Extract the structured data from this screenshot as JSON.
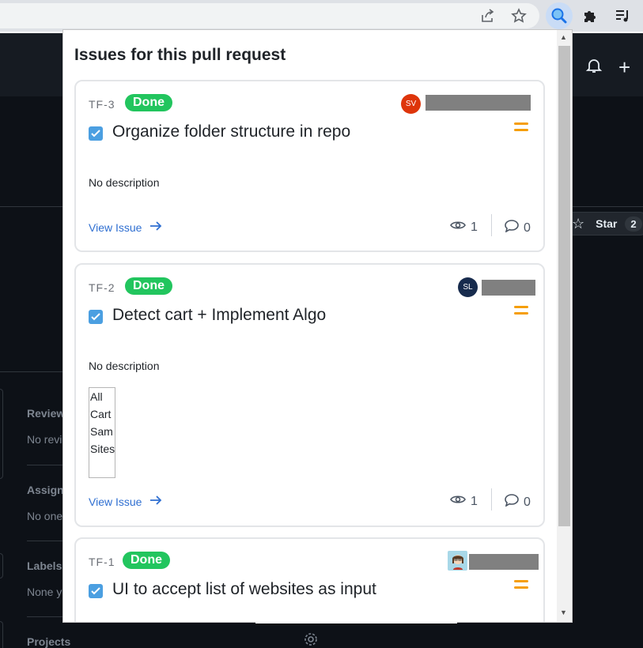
{
  "browser": {
    "icons": [
      "share-icon",
      "bookmark-star-icon",
      "search-extension-icon",
      "puzzle-extensions-icon",
      "reading-list-icon"
    ]
  },
  "github": {
    "star_label": "Star",
    "star_count": "2",
    "sidebar": [
      {
        "label": "Reviewers",
        "value": "No reviewers"
      },
      {
        "label": "Assignees",
        "value": "No one"
      },
      {
        "label": "Labels",
        "value": "None yet"
      },
      {
        "label": "Projects",
        "value": ""
      }
    ]
  },
  "popup": {
    "title": "Issues for this pull request",
    "issues": [
      {
        "key": "TF-3",
        "status": "Done",
        "avatar_initials": "SV",
        "avatar_color": "#de350b",
        "title": "Organize folder structure in repo",
        "description": "No description",
        "view_label": "View Issue",
        "watchers": "1",
        "comments": "0"
      },
      {
        "key": "TF-2",
        "status": "Done",
        "avatar_initials": "SL",
        "avatar_color": "#172b4d",
        "title": "Detect cart + Implement Algo",
        "description": "No description",
        "image_alt": "All Cart Sam Sites",
        "view_label": "View Issue",
        "watchers": "1",
        "comments": "0"
      },
      {
        "key": "TF-1",
        "status": "Done",
        "title": "UI to accept list of websites as input"
      }
    ]
  },
  "colors": {
    "done_badge": "#22c55e",
    "link": "#2f6fd1",
    "priority": "#f59e0b"
  }
}
